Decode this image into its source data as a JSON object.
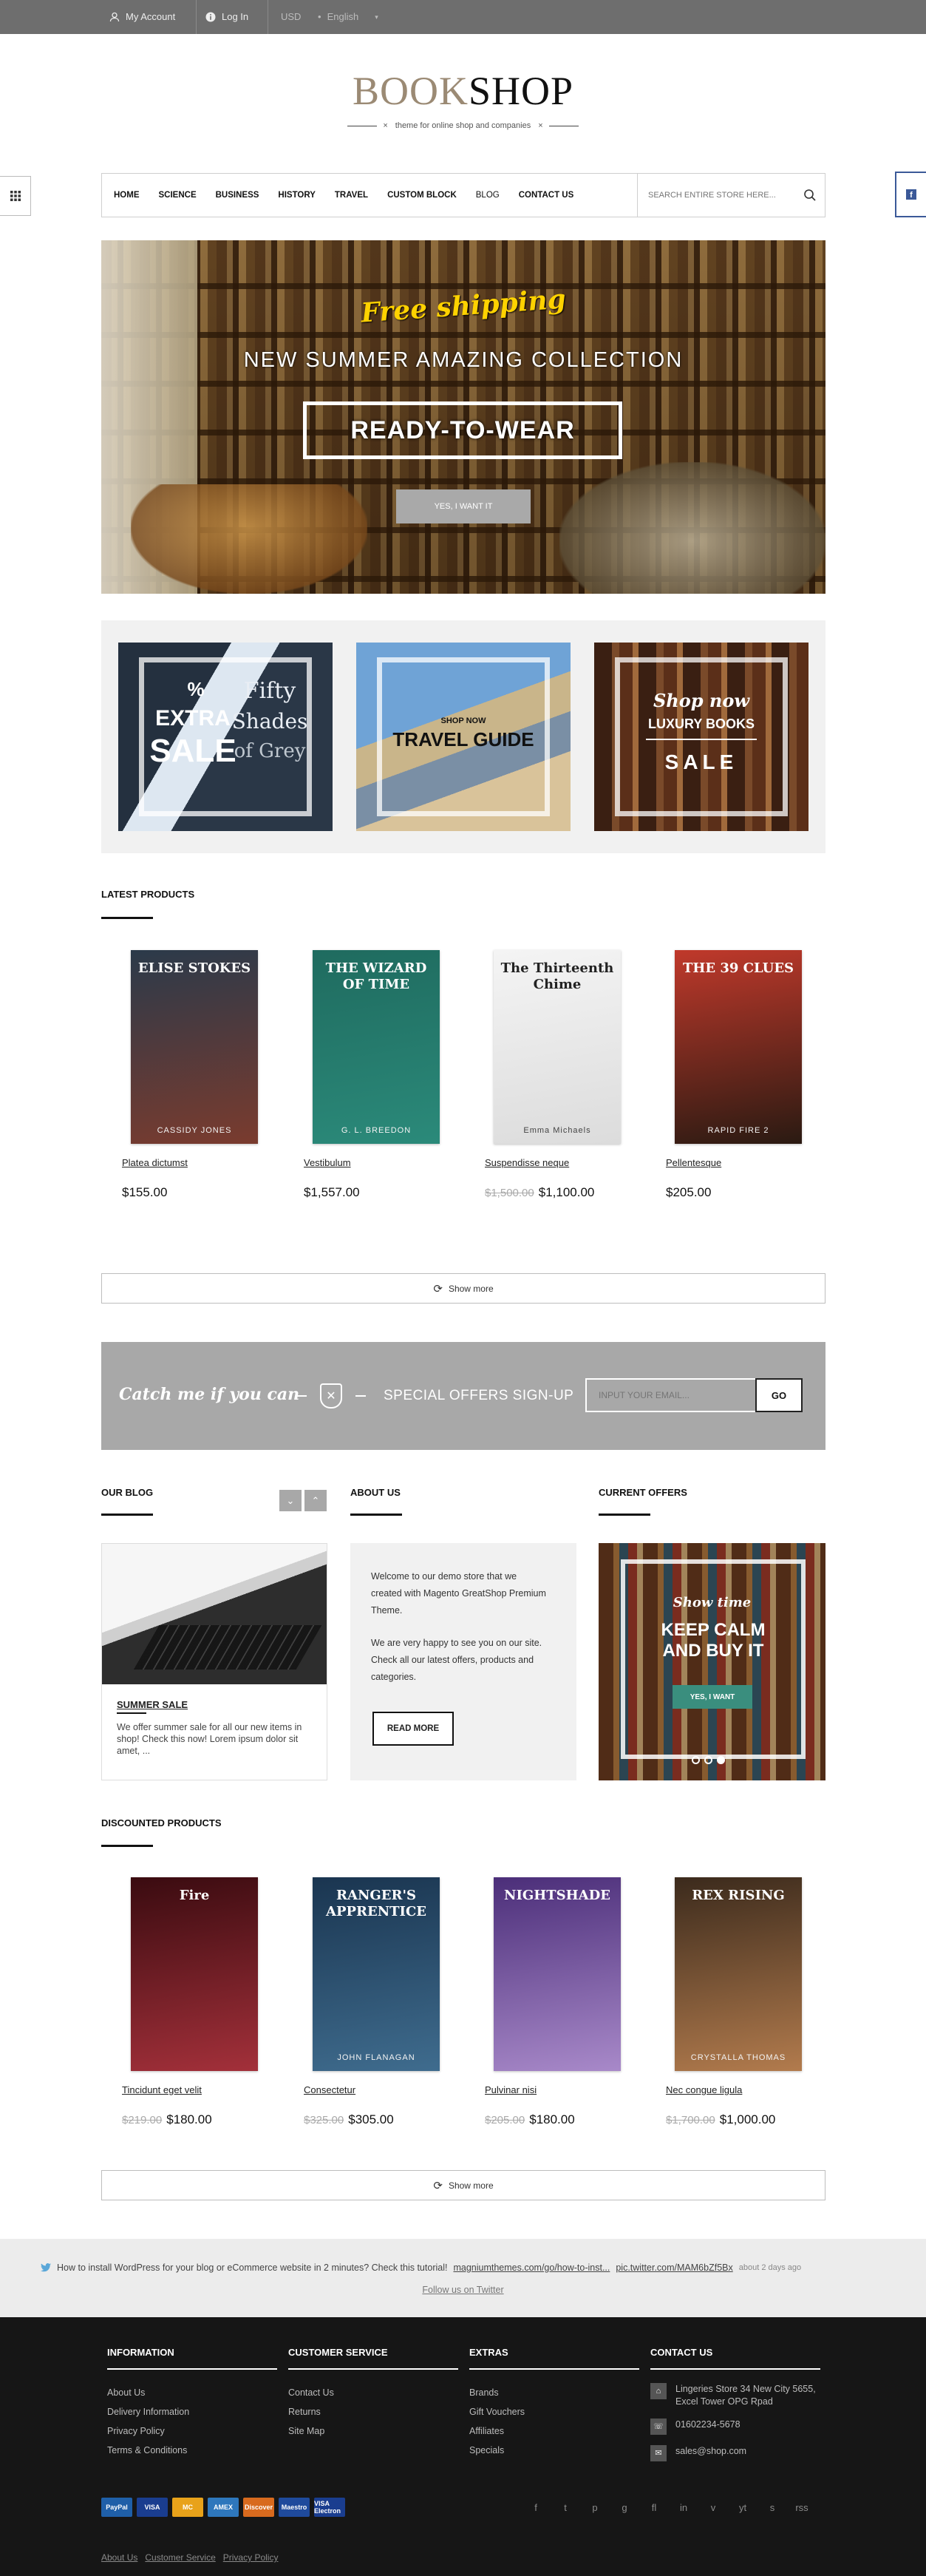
{
  "topbar": {
    "my_account": "My Account",
    "log_in": "Log In",
    "currency": "USD",
    "language": "English",
    "bullet": "•"
  },
  "logo": {
    "part1": "BOOK",
    "part2": "SHOP",
    "tagline": "theme for online shop and companies",
    "cross": "×"
  },
  "nav": {
    "items": [
      "HOME",
      "SCIENCE",
      "BUSINESS",
      "HISTORY",
      "TRAVEL",
      "CUSTOM BLOCK",
      "BLOG",
      "CONTACT US"
    ],
    "search_placeholder": "SEARCH ENTIRE STORE HERE..."
  },
  "side": {
    "facebook_letter": "f"
  },
  "hero": {
    "free_shipping": "Free shipping",
    "collection": "NEW SUMMER AMAZING COLLECTION",
    "ready": "READY-TO-WEAR",
    "button": "YES, I WANT IT"
  },
  "banners": [
    {
      "l1": "%",
      "l2": "EXTRA",
      "l3": "SALE",
      "r1": "Fifty",
      "r2": "Shades",
      "r3": "of Grey"
    },
    {
      "l1": "SHOP NOW",
      "l2": "TRAVEL GUIDE"
    },
    {
      "l1": "Shop now",
      "l2": "LUXURY BOOKS",
      "l3": "SALE"
    }
  ],
  "latest": {
    "heading": "LATEST PRODUCTS",
    "products": [
      {
        "name": "Platea dictumst",
        "old": "",
        "price": "$155.00",
        "cover_title": "ELISE STOKES",
        "cover_sub": "CASSIDY JONES",
        "colors": [
          "#2b3a4a",
          "#7a3b2e"
        ]
      },
      {
        "name": "Vestibulum",
        "old": "",
        "price": "$1,557.00",
        "cover_title": "THE WIZARD OF TIME",
        "cover_sub": "G. L. BREEDON",
        "colors": [
          "#1f6b5f",
          "#2b8a7a"
        ]
      },
      {
        "name": "Suspendisse neque",
        "old": "$1,500.00",
        "price": "$1,100.00",
        "cover_title": "The Thirteenth Chime",
        "cover_sub": "Emma Michaels",
        "colors": [
          "#f4f4f4",
          "#dcdcdc"
        ]
      },
      {
        "name": "Pellentesque",
        "old": "",
        "price": "$205.00",
        "cover_title": "THE 39 CLUES",
        "cover_sub": "RAPID FIRE 2",
        "colors": [
          "#c0392b",
          "#2a1a12"
        ]
      }
    ],
    "show_more": "Show more"
  },
  "newsletter": {
    "catch": "Catch me if you can",
    "title": "SPECIAL OFFERS SIGN-UP",
    "placeholder": "INPUT YOUR EMAIL...",
    "button": "GO"
  },
  "blog": {
    "heading": "OUR BLOG",
    "post_title": "SUMMER SALE",
    "post_text": "We offer summer sale for all our new items in shop! Check this now! Lorem ipsum dolor sit amet, ..."
  },
  "about": {
    "heading": "ABOUT US",
    "p1": "Welcome to our demo store that we created with Magento GreatShop Premium Theme.",
    "p2": "We are very happy to see you on our site. Check all our latest offers, products and categories.",
    "button": "READ MORE"
  },
  "offers": {
    "heading": "CURRENT OFFERS",
    "l1": "Show time",
    "l2": "KEEP CALM AND BUY IT",
    "button": "YES, I WANT"
  },
  "discounted": {
    "heading": "DISCOUNTED PRODUCTS",
    "products": [
      {
        "name": "Tincidunt eget velit",
        "old": "$219.00",
        "price": "$180.00",
        "cover_title": "Fire",
        "cover_sub": "",
        "colors": [
          "#3a0b10",
          "#a3303a"
        ]
      },
      {
        "name": "Consectetur",
        "old": "$325.00",
        "price": "$305.00",
        "cover_title": "RANGER'S APPRENTICE",
        "cover_sub": "JOHN FLANAGAN",
        "colors": [
          "#1a3550",
          "#3f6c8e"
        ]
      },
      {
        "name": "Pulvinar nisi",
        "old": "$205.00",
        "price": "$180.00",
        "cover_title": "NIGHTSHADE",
        "cover_sub": "",
        "colors": [
          "#4b2e79",
          "#a889c9"
        ]
      },
      {
        "name": "Nec congue ligula",
        "old": "$1,700.00",
        "price": "$1,000.00",
        "cover_title": "REX RISING",
        "cover_sub": "CRYSTALLA THOMAS",
        "colors": [
          "#3b2a1c",
          "#b27b4d"
        ]
      }
    ],
    "show_more": "Show more"
  },
  "twitter": {
    "text": "How to install WordPress for your blog or eCommerce website in 2 minutes? Check this tutorial!",
    "link1": "magniumthemes.com/go/how-to-inst...",
    "link2": "pic.twitter.com/MAM6bZf5Bx",
    "time": "about 2 days ago",
    "follow": "Follow us on Twitter"
  },
  "footer": {
    "information": {
      "title": "INFORMATION",
      "items": [
        "About Us",
        "Delivery Information",
        "Privacy Policy",
        "Terms & Conditions"
      ]
    },
    "customer": {
      "title": "CUSTOMER SERVICE",
      "items": [
        "Contact Us",
        "Returns",
        "Site Map"
      ]
    },
    "extras": {
      "title": "EXTRAS",
      "items": [
        "Brands",
        "Gift Vouchers",
        "Affiliates",
        "Specials"
      ]
    },
    "contact": {
      "title": "CONTACT US",
      "address": "Lingeries Store 34 New City 5655, Excel Tower OPG Rpad",
      "phone": "01602234-5678",
      "email": "sales@shop.com"
    },
    "payments": [
      "PayPal",
      "VISA",
      "MC",
      "AMEX",
      "Discover",
      "Maestro",
      "VISA Electron"
    ],
    "social": [
      "f",
      "t",
      "p",
      "g",
      "fl",
      "in",
      "v",
      "yt",
      "s",
      "rss"
    ],
    "bottom_links": [
      "About Us",
      "Customer Service",
      "Privacy Policy"
    ]
  }
}
